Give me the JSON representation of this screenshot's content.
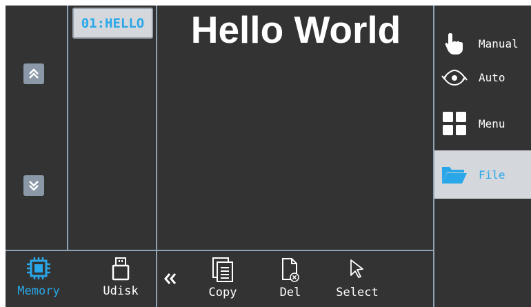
{
  "nav": {
    "scroll_up_icon": "double-chevron-up",
    "scroll_down_icon": "double-chevron-down"
  },
  "file_list": {
    "items": [
      {
        "label": "01:HELLO",
        "selected": true
      }
    ]
  },
  "preview": {
    "text": "Hello World"
  },
  "sidebar": {
    "items": [
      {
        "label": "Manual",
        "icon": "hand-pointer-icon",
        "active": false
      },
      {
        "label": "Auto",
        "icon": "eye-cycle-icon",
        "active": false
      },
      {
        "label": "Menu",
        "icon": "grid-icon",
        "active": false
      },
      {
        "label": "File",
        "icon": "folder-open-icon",
        "active": true
      }
    ]
  },
  "storage": {
    "items": [
      {
        "label": "Memory",
        "icon": "chip-icon",
        "active": true
      },
      {
        "label": "Udisk",
        "icon": "usb-drive-icon",
        "active": false
      }
    ]
  },
  "actions": {
    "back_icon": "double-chevron-left",
    "items": [
      {
        "label": "Copy",
        "icon": "copy-icon"
      },
      {
        "label": "Del",
        "icon": "delete-file-icon"
      },
      {
        "label": "Select",
        "icon": "cursor-icon"
      }
    ]
  },
  "colors": {
    "background": "#333333",
    "divider": "#8ea2b5",
    "accent": "#2aa7e8",
    "selected_bg": "#d4d8dc",
    "button": "#8a98a7"
  }
}
